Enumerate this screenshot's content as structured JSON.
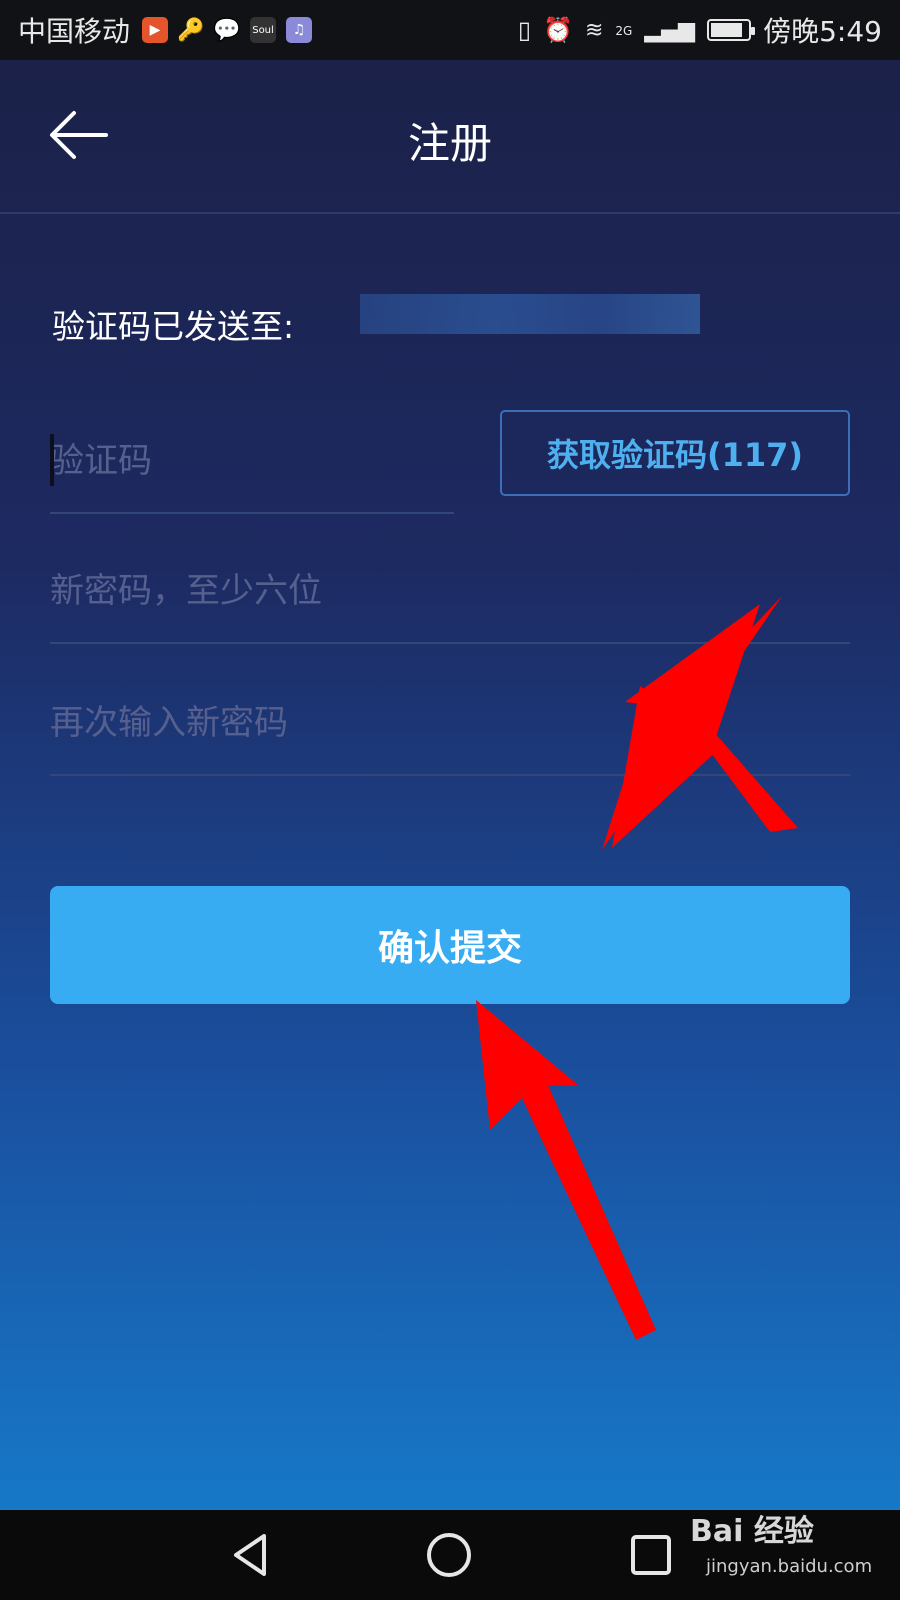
{
  "status_bar": {
    "carrier": "中国移动",
    "network": "2G",
    "time": "傍晚5:49",
    "battery_level": 0.85
  },
  "header": {
    "title": "注册",
    "back_icon": "arrow-left-icon"
  },
  "verification": {
    "sent_label": "验证码已发送至:"
  },
  "form": {
    "code_placeholder": "验证码",
    "get_code_label": "获取验证码(117)",
    "new_password_placeholder": "新密码，至少六位",
    "confirm_password_placeholder": "再次输入新密码",
    "submit_label": "确认提交"
  },
  "watermark": {
    "brand": "Bai 经验",
    "url": "jingyan.baidu.com"
  },
  "colors": {
    "accent": "#38acf2",
    "annotation_arrow": "#ff0000"
  }
}
